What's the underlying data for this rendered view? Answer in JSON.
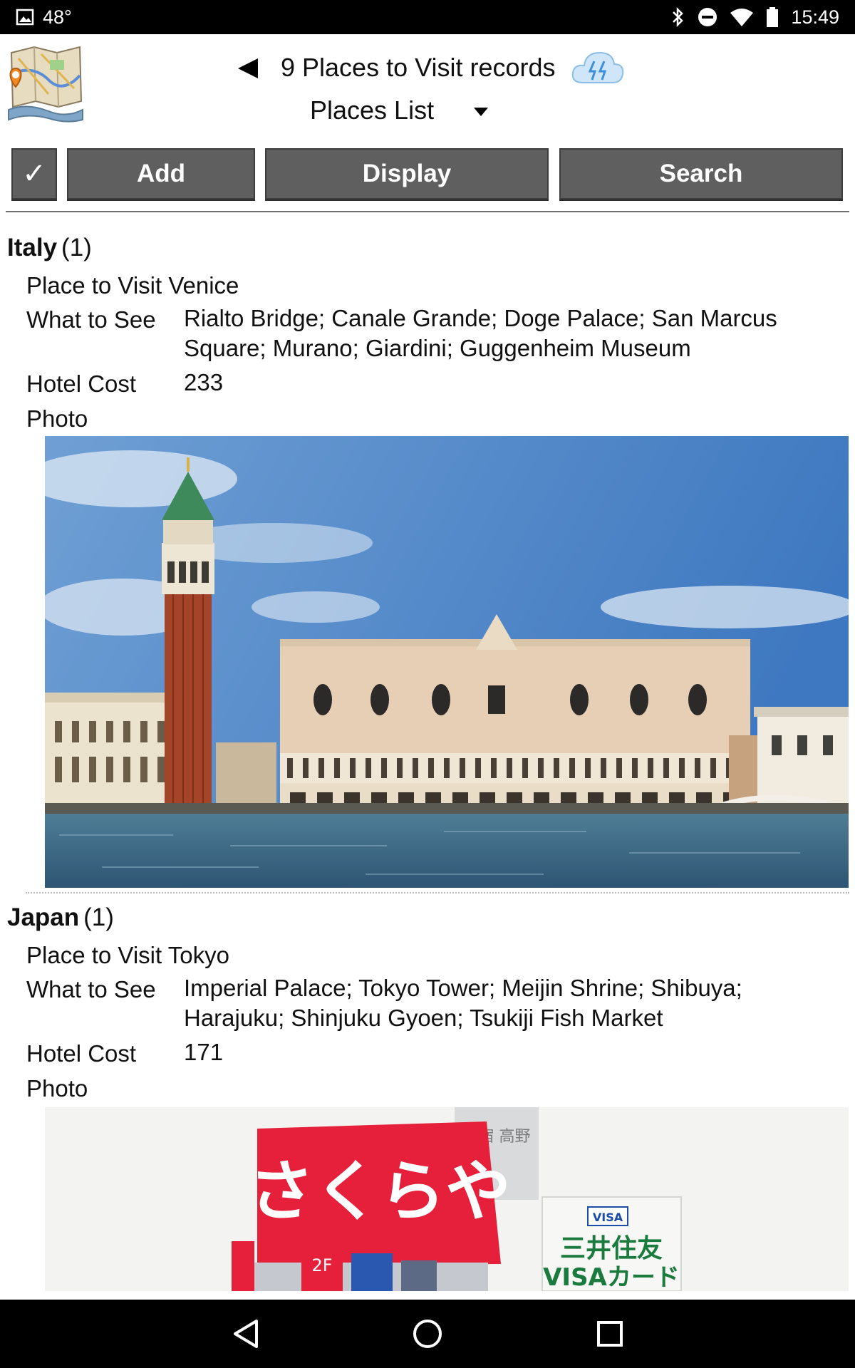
{
  "status_bar": {
    "temperature": "48°",
    "time": "15:49",
    "icons": [
      "image-notification-icon",
      "bluetooth-icon",
      "do-not-disturb-icon",
      "wifi-icon",
      "battery-icon"
    ]
  },
  "header": {
    "records_title": "9 Places to Visit records",
    "list_title": "Places List",
    "icons": [
      "app-logo-map-icon",
      "back-arrow-icon",
      "cloud-sync-icon",
      "dropdown-arrow-icon"
    ]
  },
  "toolbar": {
    "check_label": "✓",
    "add_label": "Add",
    "display_label": "Display",
    "search_label": "Search"
  },
  "groups": [
    {
      "name": "Italy",
      "count": "(1)",
      "place_label": "Place to Visit",
      "place": "Venice",
      "what_label": "What to See",
      "what": "Rialto Bridge; Canale Grande; Doge Palace; San Marcus Square; Murano; Giardini; Guggenheim Museum",
      "cost_label": "Hotel Cost",
      "cost": "233",
      "photo_label": "Photo"
    },
    {
      "name": "Japan",
      "count": "(1)",
      "place_label": "Place to Visit",
      "place": "Tokyo",
      "what_label": "What to See",
      "what": "Imperial Palace; Tokyo Tower; Meijin Shrine; Shibuya; Harajuku; Shinjuku Gyoen; Tsukiji Fish Market",
      "cost_label": "Hotel Cost",
      "cost": "171",
      "photo_label": "Photo"
    }
  ],
  "photo_text": {
    "tokyo_sign": "さくらや",
    "tokyo_tower_sign": "新宿 高野",
    "tokyo_visa_logo": "VISA",
    "tokyo_bank": "三井住友",
    "tokyo_card": "VISAカード",
    "tokyo_floor": "2F"
  },
  "nav_bar": {
    "icons": [
      "nav-back-icon",
      "nav-home-icon",
      "nav-recents-icon"
    ]
  },
  "colors": {
    "toolbar_button": "#5f5f5f",
    "status_bar": "#000000",
    "sky": "#4a84c8",
    "water": "#3d6a8c",
    "sign_red": "#e6203a"
  }
}
